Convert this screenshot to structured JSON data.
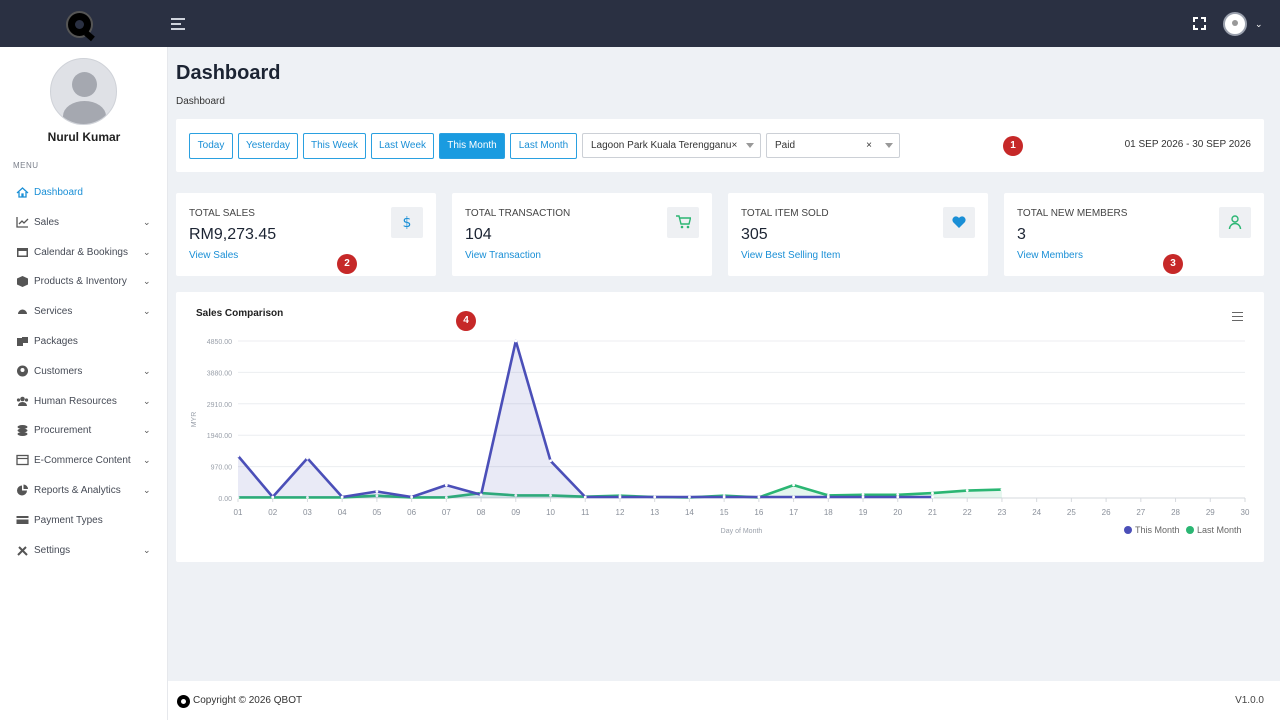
{
  "user": {
    "name": "Nurul Kumar"
  },
  "sidebar": {
    "menu_title": "MENU",
    "items": [
      {
        "label": "Dashboard",
        "icon": "home-icon",
        "active": true,
        "has_children": false
      },
      {
        "label": "Sales",
        "icon": "line-chart-icon",
        "has_children": true
      },
      {
        "label": "Calendar & Bookings",
        "icon": "calendar-icon",
        "has_children": true
      },
      {
        "label": "Products & Inventory",
        "icon": "box-icon",
        "has_children": true
      },
      {
        "label": "Services",
        "icon": "bell-service-icon",
        "has_children": true
      },
      {
        "label": "Packages",
        "icon": "packages-icon",
        "has_children": false
      },
      {
        "label": "Customers",
        "icon": "user-circle-icon",
        "has_children": true
      },
      {
        "label": "Human Resources",
        "icon": "users-icon",
        "has_children": true
      },
      {
        "label": "Procurement",
        "icon": "coins-icon",
        "has_children": true
      },
      {
        "label": "E-Commerce Content",
        "icon": "layout-icon",
        "has_children": true
      },
      {
        "label": "Reports & Analytics",
        "icon": "pie-chart-icon",
        "has_children": true
      },
      {
        "label": "Payment Types",
        "icon": "credit-card-icon",
        "has_children": false
      },
      {
        "label": "Settings",
        "icon": "tools-icon",
        "has_children": true
      }
    ]
  },
  "page": {
    "title": "Dashboard",
    "breadcrumb": "Dashboard"
  },
  "filters": {
    "buttons": [
      "Today",
      "Yesterday",
      "This Week",
      "Last Week",
      "This Month",
      "Last Month"
    ],
    "active_button": "This Month",
    "location": "Lagoon Park Kuala Terengganu",
    "location_clear": "×",
    "status": "Paid",
    "status_clear": "×",
    "date_range": "01 SEP 2026 - 30 SEP 2026"
  },
  "badges": [
    "1",
    "2",
    "3",
    "4"
  ],
  "stats": [
    {
      "label": "TOTAL SALES",
      "value": "RM9,273.45",
      "link": "View Sales",
      "icon": "dollar-icon",
      "color": "#1a8fd6"
    },
    {
      "label": "TOTAL TRANSACTION",
      "value": "104",
      "link": "View Transaction",
      "icon": "cart-icon",
      "color": "#2bb673"
    },
    {
      "label": "TOTAL ITEM SOLD",
      "value": "305",
      "link": "View Best Selling Item",
      "icon": "heart-icon",
      "color": "#1a8fd6"
    },
    {
      "label": "TOTAL NEW MEMBERS",
      "value": "3",
      "link": "View Members",
      "icon": "user-icon",
      "color": "#2bb673"
    }
  ],
  "chart_data": {
    "type": "line",
    "title": "Sales Comparison",
    "xlabel": "Day of Month",
    "ylabel": "MYR",
    "ylim": [
      0,
      4850
    ],
    "yticks": [
      "0.00",
      "970.00",
      "1940.00",
      "2910.00",
      "3880.00",
      "4850.00"
    ],
    "categories": [
      "01",
      "02",
      "03",
      "04",
      "05",
      "06",
      "07",
      "08",
      "09",
      "10",
      "11",
      "12",
      "13",
      "14",
      "15",
      "16",
      "17",
      "18",
      "19",
      "20",
      "21",
      "22",
      "23",
      "24",
      "25",
      "26",
      "27",
      "28",
      "29",
      "30"
    ],
    "series": [
      {
        "name": "This Month",
        "color": "#4b4fb8",
        "values": [
          1300,
          30,
          1230,
          30,
          200,
          30,
          400,
          100,
          4850,
          1150,
          30,
          30,
          30,
          30,
          30,
          30,
          30,
          30,
          30,
          30,
          30,
          null,
          null,
          null,
          null,
          null,
          null,
          null,
          null,
          null
        ]
      },
      {
        "name": "Last Month",
        "color": "#2bb673",
        "values": [
          20,
          20,
          20,
          20,
          70,
          20,
          20,
          150,
          80,
          80,
          40,
          70,
          30,
          20,
          70,
          20,
          400,
          80,
          100,
          100,
          150,
          230,
          260,
          null,
          null,
          null,
          null,
          null,
          null,
          null
        ]
      }
    ],
    "legend_position": "bottom-right",
    "grid": true
  },
  "footer": {
    "copyright": "Copyright © 2026 QBOT",
    "version": "V1.0.0"
  }
}
